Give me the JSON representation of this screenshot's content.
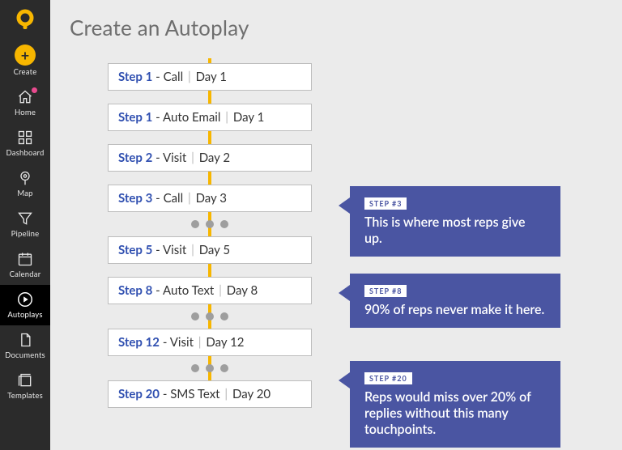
{
  "brand": {
    "accent": "#f7b600",
    "callout_bg": "#4a55a2"
  },
  "sidebar": {
    "items": [
      {
        "label": "Create",
        "icon": "plus-circle-icon"
      },
      {
        "label": "Home",
        "icon": "home-icon"
      },
      {
        "label": "Dashboard",
        "icon": "grid-icon"
      },
      {
        "label": "Map",
        "icon": "pin-icon"
      },
      {
        "label": "Pipeline",
        "icon": "funnel-icon"
      },
      {
        "label": "Calendar",
        "icon": "calendar-icon"
      },
      {
        "label": "Autoplays",
        "icon": "autoplay-icon"
      },
      {
        "label": "Documents",
        "icon": "document-icon"
      },
      {
        "label": "Templates",
        "icon": "templates-icon"
      }
    ],
    "active_index": 6,
    "notification_index": 1
  },
  "page": {
    "title": "Create an Autoplay"
  },
  "steps": [
    {
      "num": "Step 1",
      "action": "Call",
      "day": "Day 1"
    },
    {
      "num": "Step 1",
      "action": "Auto Email",
      "day": "Day 1"
    },
    {
      "num": "Step 2",
      "action": "Visit",
      "day": "Day 2"
    },
    {
      "num": "Step 3",
      "action": "Call",
      "day": "Day 3"
    },
    {
      "num": "Step 5",
      "action": "Visit",
      "day": "Day 5"
    },
    {
      "num": "Step 8",
      "action": "Auto Text",
      "day": "Day 8"
    },
    {
      "num": "Step 12",
      "action": "Visit",
      "day": "Day 12"
    },
    {
      "num": "Step 20",
      "action": "SMS Text",
      "day": "Day 20"
    }
  ],
  "gaps_after_index": [
    3,
    5,
    6
  ],
  "callouts": [
    {
      "tag": "STEP #3",
      "body": "This is where most reps give up."
    },
    {
      "tag": "STEP #8",
      "body": "90% of reps never make it here."
    },
    {
      "tag": "STEP #20",
      "body": "Reps would miss over 20% of replies without this many touchpoints."
    }
  ]
}
